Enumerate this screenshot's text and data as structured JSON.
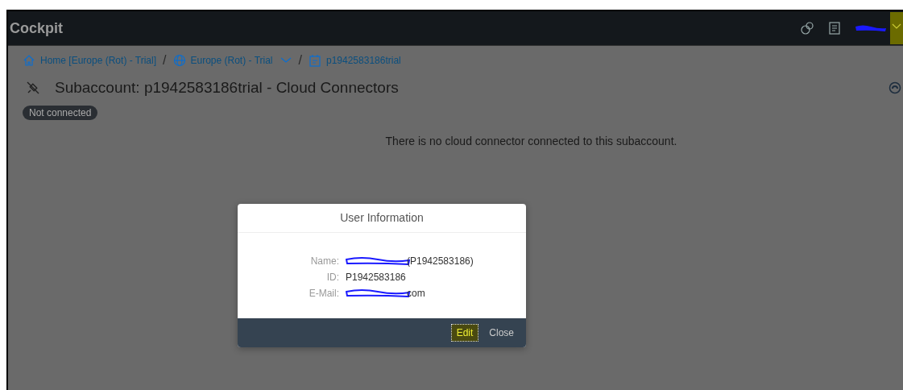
{
  "shell": {
    "title": "Cockpit"
  },
  "breadcrumbs": [
    {
      "kind": "home",
      "label": "Home [Europe (Rot) - Trial]",
      "dropdown": false
    },
    {
      "kind": "region",
      "separator": "/",
      "label": "Europe (Rot) - Trial",
      "dropdown": true
    },
    {
      "kind": "subaccount",
      "separator": "/",
      "label": "p1942583186trial",
      "dropdown": false
    }
  ],
  "page": {
    "title": "Subaccount: p1942583186trial - Cloud Connectors",
    "status": "Not connected",
    "message": "There is no cloud connector connected to this subaccount."
  },
  "dialog": {
    "title": "User Information",
    "fields": [
      {
        "label": "Name:",
        "value": "(P1942583186)",
        "redacted": true
      },
      {
        "label": "ID:",
        "value": "P1942583186",
        "redacted": false
      },
      {
        "label": "E-Mail:",
        "value": "com",
        "redacted": true
      }
    ],
    "buttons": [
      {
        "label": "Edit",
        "focused": true
      },
      {
        "label": "Close",
        "focused": false
      }
    ]
  }
}
